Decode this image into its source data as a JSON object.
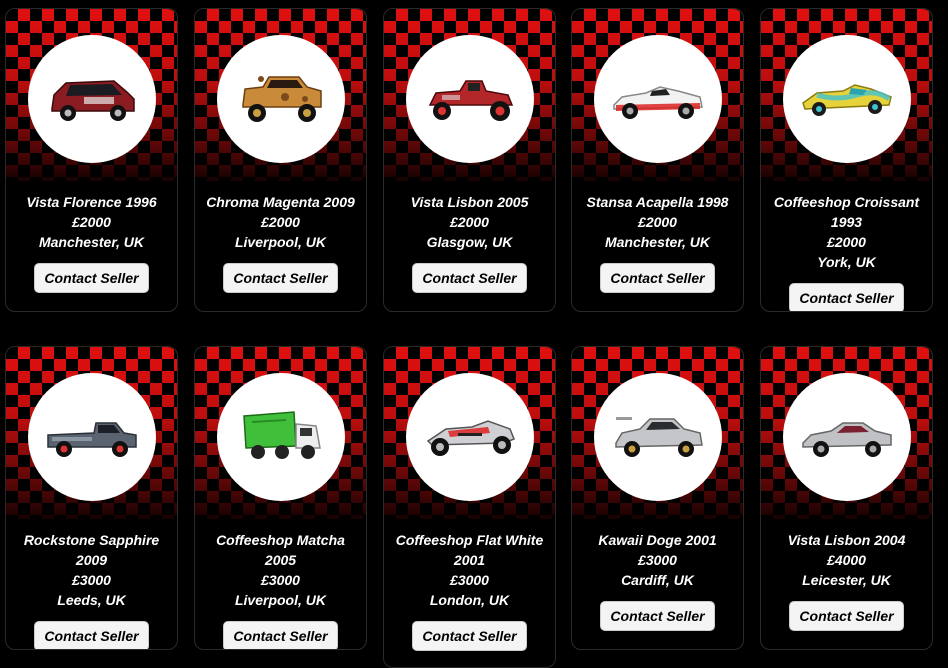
{
  "listings": [
    {
      "name": "Vista Florence 1996",
      "price": "£2000",
      "location": "Manchester, UK",
      "button": "Contact Seller",
      "car_color": "#8a1c22",
      "car_icon": "suv-icon"
    },
    {
      "name": "Chroma Magenta 2009",
      "price": "£2000",
      "location": "Liverpool, UK",
      "button": "Contact Seller",
      "car_color": "#c98a3a",
      "car_icon": "offroad-truck-icon"
    },
    {
      "name": "Vista Lisbon 2005",
      "price": "£2000",
      "location": "Glasgow, UK",
      "button": "Contact Seller",
      "car_color": "#b3262a",
      "car_icon": "hotrod-icon"
    },
    {
      "name": "Stansa Acapella 1998",
      "price": "£2000",
      "location": "Manchester, UK",
      "button": "Contact Seller",
      "car_color": "#f2f2f2",
      "car_icon": "convertible-icon"
    },
    {
      "name": "Coffeeshop Croissant 1993",
      "price": "£2000",
      "location": "York, UK",
      "button": "Contact Seller",
      "car_color": "#e6d23a",
      "car_icon": "race-car-icon"
    },
    {
      "name": "Rockstone Sapphire 2009",
      "price": "£3000",
      "location": "Leeds, UK",
      "button": "Contact Seller",
      "car_color": "#5a6470",
      "car_icon": "pickup-truck-icon"
    },
    {
      "name": "Coffeeshop Matcha 2005",
      "price": "£3000",
      "location": "Liverpool, UK",
      "button": "Contact Seller",
      "car_color": "#3fbf3a",
      "car_icon": "garbage-truck-icon"
    },
    {
      "name": "Coffeeshop Flat White 2001",
      "price": "£3000",
      "location": "London, UK",
      "button": "Contact Seller",
      "car_color": "#cfcfd4",
      "car_icon": "formula-car-icon"
    },
    {
      "name": "Kawaii Doge 2001",
      "price": "£3000",
      "location": "Cardiff, UK",
      "button": "Contact Seller",
      "car_color": "#c4c6c9",
      "car_icon": "sedan-icon"
    },
    {
      "name": "Vista Lisbon 2004",
      "price": "£4000",
      "location": "Leicester, UK",
      "button": "Contact Seller",
      "car_color": "#bfc1c4",
      "car_icon": "coupe-icon"
    }
  ],
  "theme": {
    "accent": "#e01010",
    "background": "#000000"
  }
}
